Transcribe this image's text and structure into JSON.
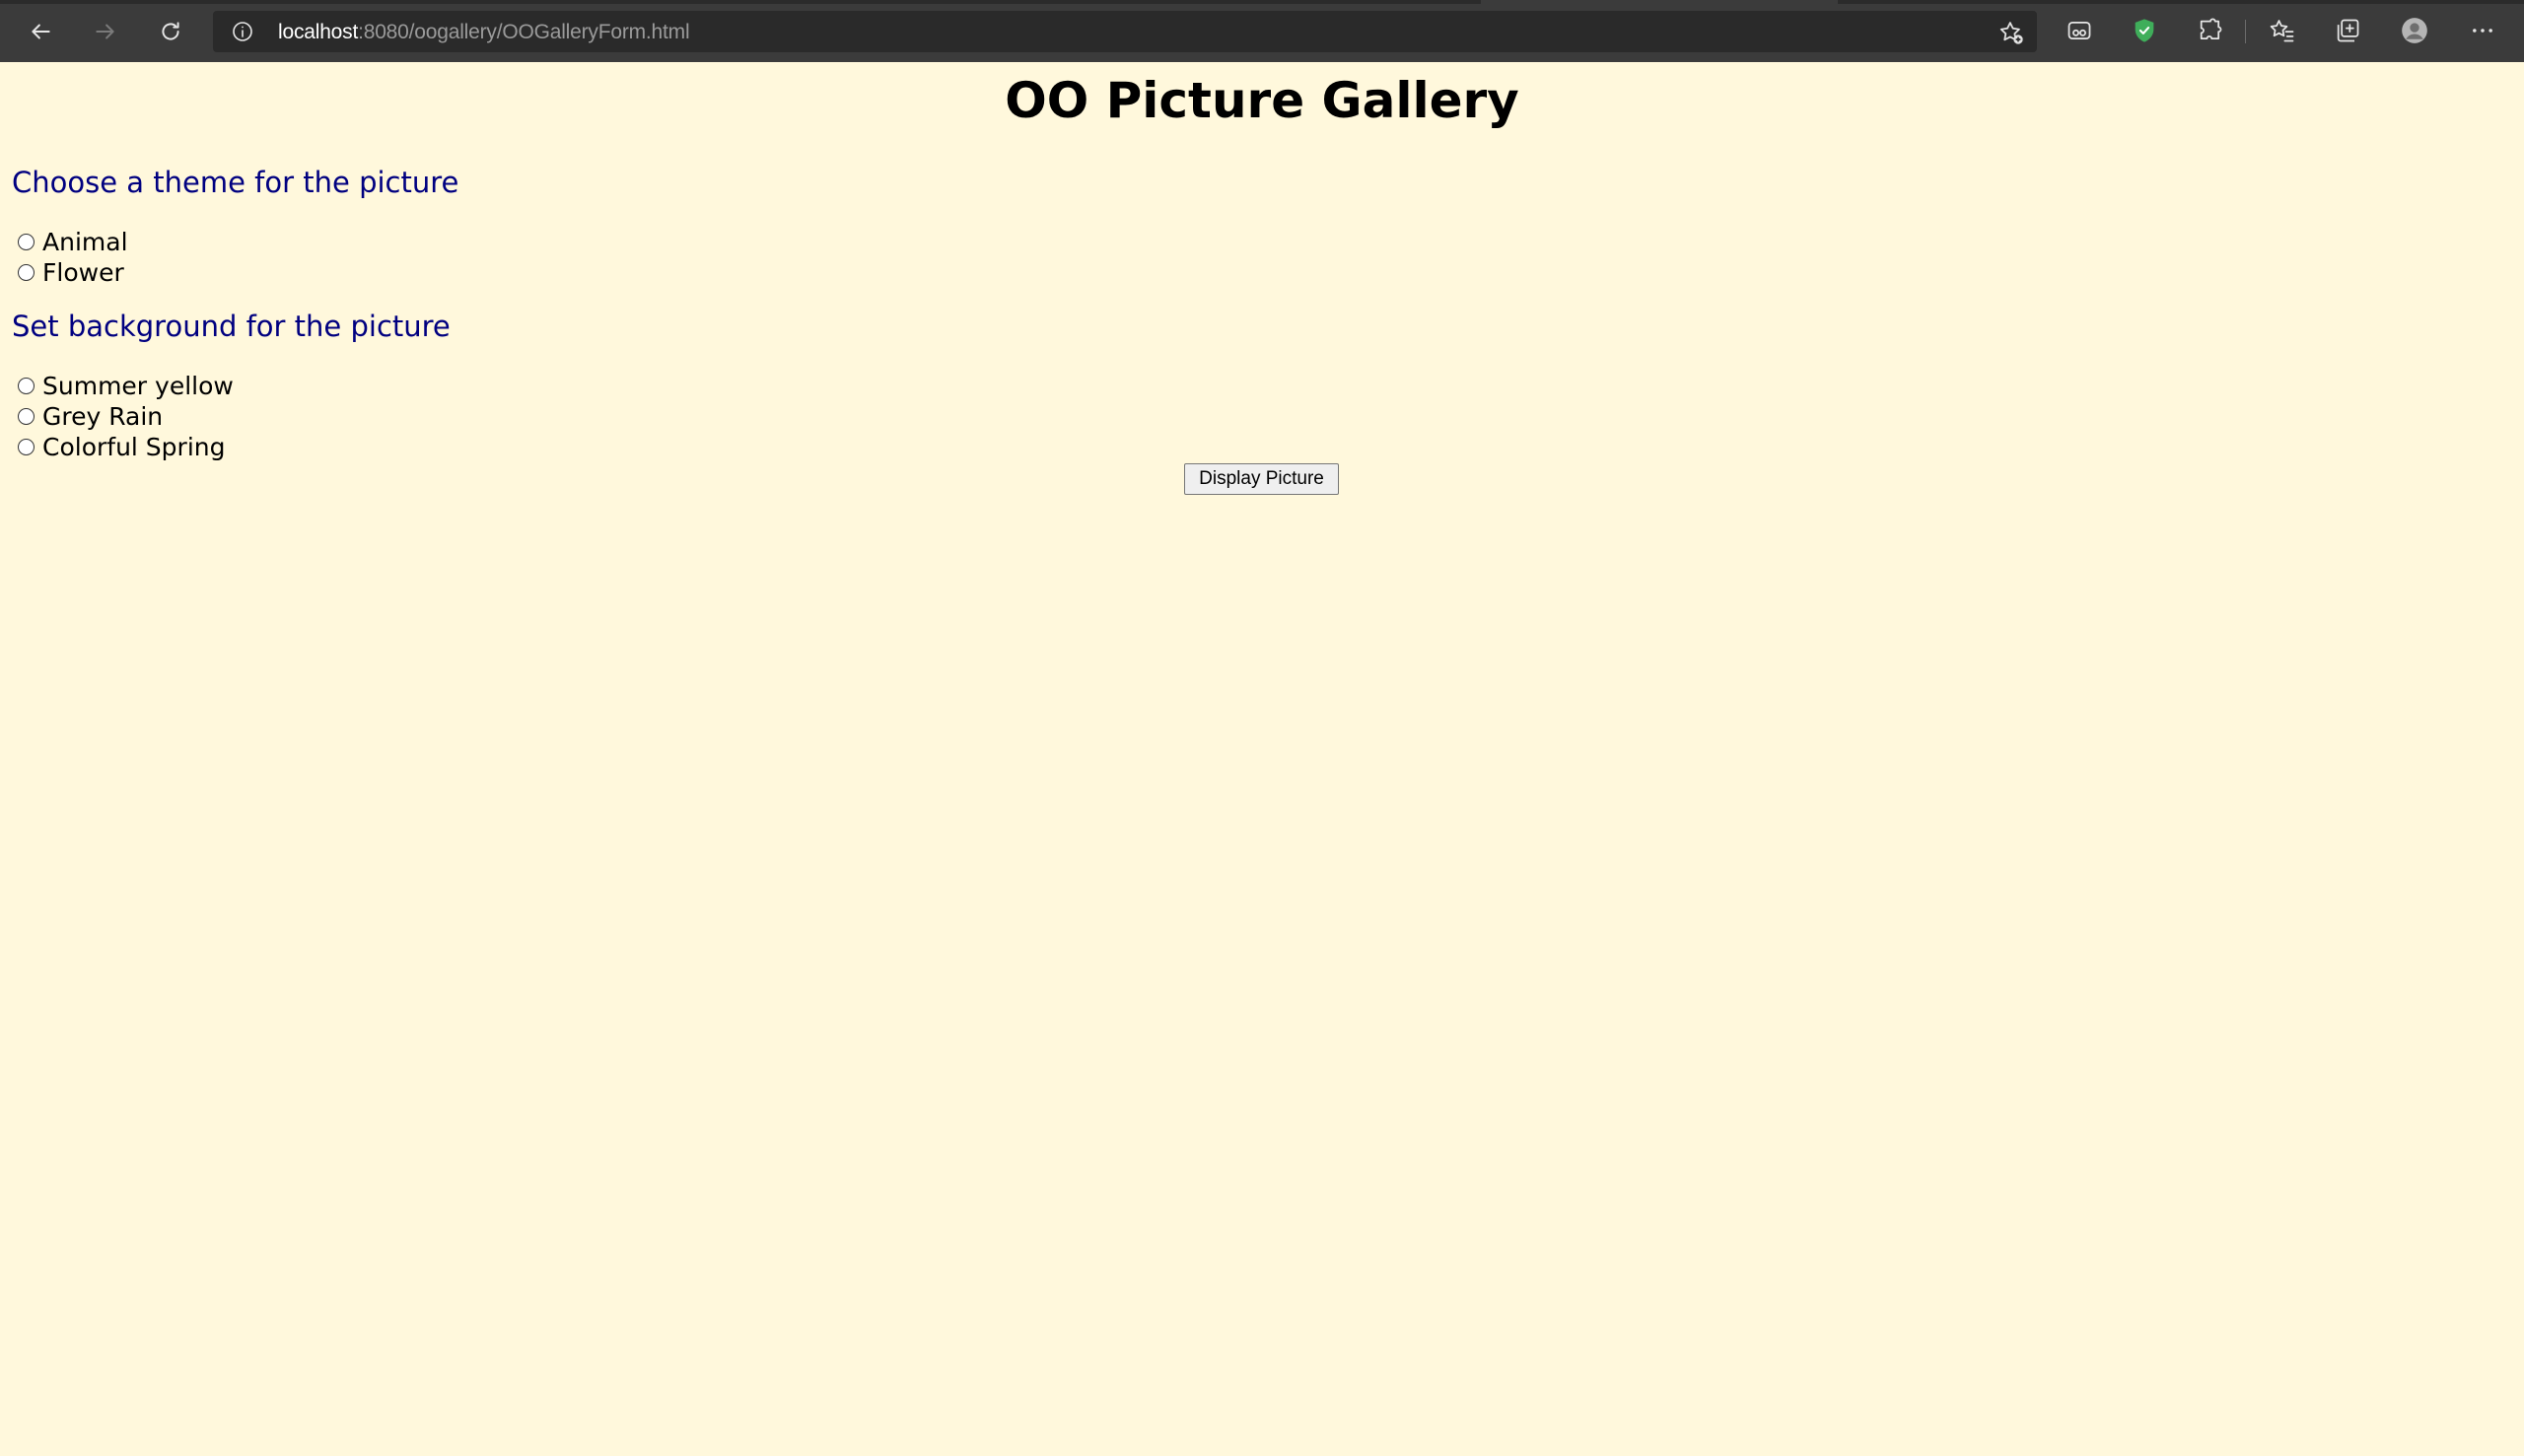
{
  "browser": {
    "url_host": "localhost",
    "url_rest": ":8080/oogallery/OOGalleryForm.html",
    "icons": {
      "back": "back-arrow-icon",
      "forward": "forward-arrow-icon",
      "refresh": "refresh-icon",
      "site_info": "info-icon",
      "add_favorite": "add-favorite-icon",
      "tracking": "glasses-icon",
      "shield": "shield-icon",
      "extensions": "puzzle-icon",
      "favorites": "favorites-icon",
      "collections": "collections-icon",
      "profile": "profile-avatar-icon",
      "menu": "more-icon"
    }
  },
  "page": {
    "title": "OO Picture Gallery",
    "background_color": "#fff8dc",
    "heading_color": "#000080",
    "theme_section": {
      "heading": "Choose a theme for the picture",
      "options": [
        "Animal",
        "Flower"
      ]
    },
    "background_section": {
      "heading": "Set background for the picture",
      "options": [
        "Summer yellow",
        "Grey Rain",
        "Colorful Spring"
      ]
    },
    "submit_label": "Display Picture"
  }
}
